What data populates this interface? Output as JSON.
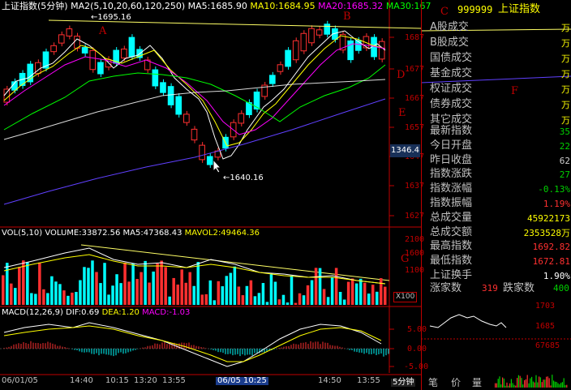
{
  "header": {
    "title": "上证指数(5分钟)",
    "ma2": "MA2(5,10,20,60,120,250)",
    "ma5": "MA5:1685.90",
    "ma10": "MA10:1684.95",
    "ma20": "MA20:1685.32",
    "ma30": "MA30:167"
  },
  "annotations": {
    "high_label": "1695.16",
    "low_label": "←1640.16",
    "A": "A",
    "B": "B",
    "C": "C",
    "D": "D",
    "E": "E",
    "F": "F",
    "G": "G"
  },
  "price_axis": [
    "1687",
    "1677",
    "1667",
    "1657",
    "1647",
    "1637",
    "1627"
  ],
  "cursor_price": "1346.4",
  "volume": {
    "header_vol": "VOL(5,10)",
    "header_volume": "VOLUME:33872.56",
    "header_ma5": "MA5:47368.43",
    "header_mavol": "MAVOL2:49464.36",
    "axis": [
      "2100",
      "1600",
      "1100"
    ],
    "unit": "X100"
  },
  "macd": {
    "header_name": "MACD(12,26,9)",
    "header_dif": "DIF:0.69",
    "header_dea": "DEA:1.20",
    "header_macd": "MACD:-1.03"
  },
  "time_axis": [
    "06/01/05",
    "14:40",
    "10:15",
    "13:20",
    "13:55",
    "",
    "06/05 10:25",
    "",
    "",
    "14:50",
    "",
    "13:55"
  ],
  "panel": {
    "code": "999999",
    "name": "上证指数",
    "rows": [
      {
        "label": "A股成交",
        "value": "万"
      },
      {
        "label": "B股成交",
        "value": "万"
      },
      {
        "label": "国债成交",
        "value": "万"
      },
      {
        "label": "基金成交",
        "value": "万"
      },
      {
        "label": "权证成交",
        "value": "万"
      },
      {
        "label": "债券成交",
        "value": "万"
      },
      {
        "label": "其它成交",
        "value": "万"
      }
    ],
    "stats": [
      {
        "label": "最新指数",
        "value": "35",
        "color": "#00d000"
      },
      {
        "label": "今日开盘",
        "value": "22",
        "color": "#00d000"
      },
      {
        "label": "昨日收盘",
        "value": "62",
        "color": "#d0d0d0"
      },
      {
        "label": "指数涨跌",
        "value": "27",
        "color": "#00d000"
      },
      {
        "label": "指数涨幅",
        "value": "-0.13%",
        "color": "#00d000"
      },
      {
        "label": "指数振幅",
        "value": "1.19%",
        "color": "#ff3030"
      },
      {
        "label": "总成交量",
        "value": "45922173",
        "color": "#ffff00"
      },
      {
        "label": "总成交额",
        "value": "2353528万",
        "color": "#ffff00"
      },
      {
        "label": "最高指数",
        "value": "1692.82",
        "color": "#ff3030"
      },
      {
        "label": "最低指数",
        "value": "1672.81",
        "color": "#ff3030"
      },
      {
        "label": "上证换手",
        "value": "1.90%",
        "color": "#ffffff"
      }
    ],
    "up_label": "涨家数",
    "up_value": "319",
    "down_label": "跌家数",
    "down_value": "400",
    "mini_axis": [
      "1703",
      "1685",
      "67685"
    ],
    "bottom_buttons": [
      "笔",
      "价",
      "量"
    ],
    "five_min": "5分钟"
  },
  "mini_left_axis": [
    "5.00",
    "0.00",
    "-5.00"
  ]
}
